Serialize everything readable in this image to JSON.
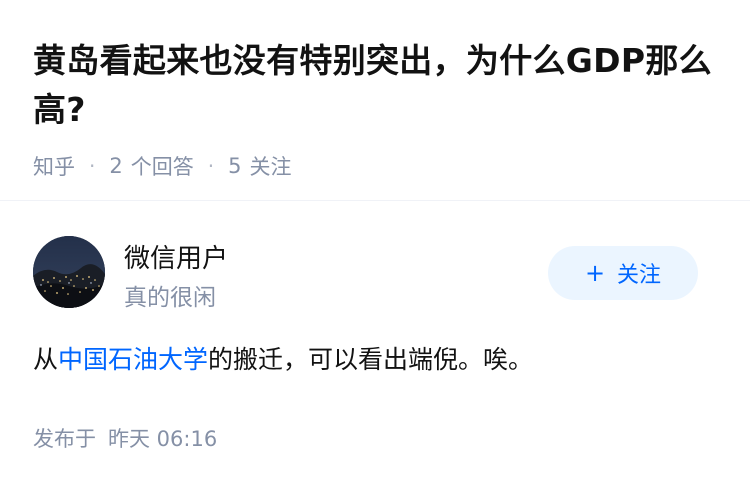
{
  "question": {
    "title": "黄岛看起来也没有特别突出，为什么GDP那么高?",
    "source": "知乎",
    "answer_count": "2",
    "answer_label": "个回答",
    "follower_count": "5",
    "follower_label": "关注"
  },
  "author": {
    "name": "微信用户",
    "bio": "真的很闲",
    "follow_label": "关注",
    "avatar_icon": "city-night-avatar"
  },
  "answer": {
    "text_before": "从",
    "link_text": "中国石油大学",
    "text_after": "的搬迁，可以看出端倪。唉。"
  },
  "footer": {
    "published_label": "发布于",
    "time": "昨天 06:16"
  },
  "colors": {
    "accent": "#0066ff",
    "follow_bg": "#ebf5ff",
    "meta": "#8590a6"
  }
}
